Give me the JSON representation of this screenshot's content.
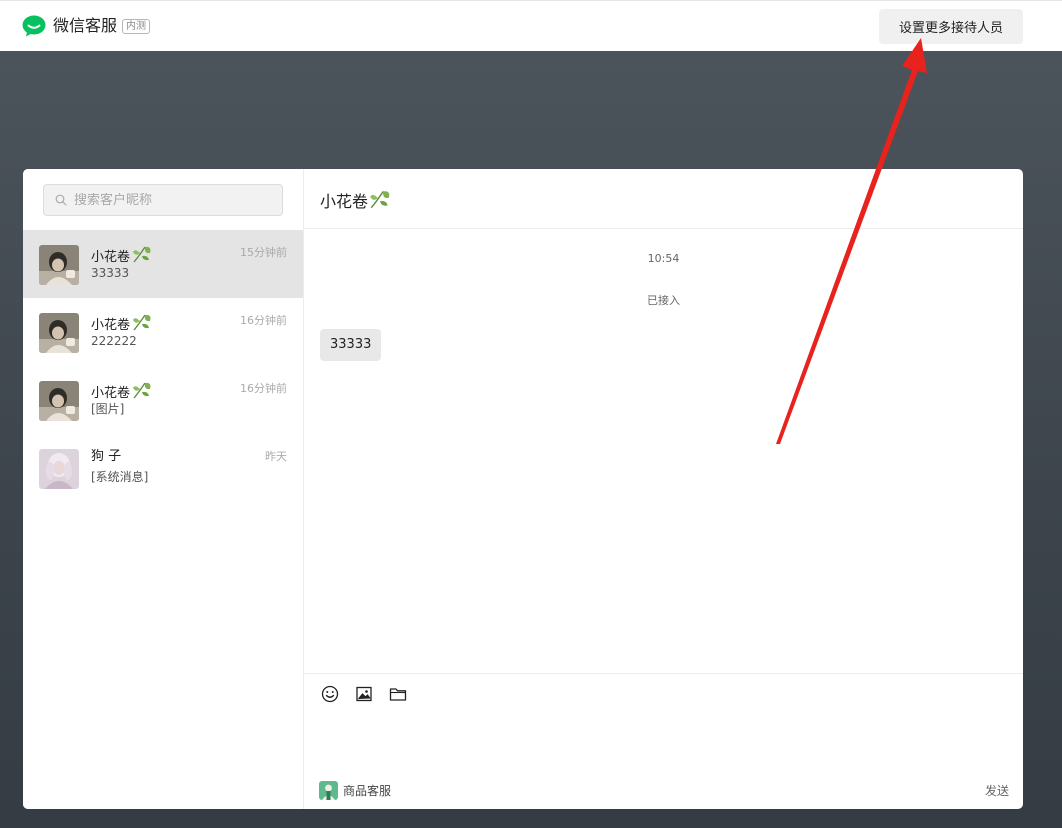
{
  "app": {
    "name": "微信客服",
    "badge": "内测",
    "brand_color": "#07c160"
  },
  "topbar": {
    "action_label": "设置更多接待人员"
  },
  "search": {
    "placeholder": "搜索客户昵称"
  },
  "conversations": [
    {
      "name": "小花卷",
      "last_message": "33333",
      "time": "15分钟前",
      "active": true,
      "avatar": "photo-portrait"
    },
    {
      "name": "小花卷",
      "last_message": "222222",
      "time": "16分钟前",
      "active": false,
      "avatar": "photo-portrait"
    },
    {
      "name": "小花卷",
      "last_message": "[图片]",
      "time": "16分钟前",
      "active": false,
      "avatar": "photo-portrait"
    },
    {
      "name": "狗 子",
      "last_message": "[系统消息]",
      "time": "昨天",
      "active": false,
      "avatar": "photo-pink"
    }
  ],
  "chat": {
    "title": "小花卷",
    "time": "10:54",
    "system_message": "已接入",
    "messages": [
      {
        "text": "33333",
        "from": "customer"
      }
    ]
  },
  "composer": {
    "tools": [
      "emoji-icon",
      "image-icon",
      "folder-icon"
    ],
    "agent_name": "商品客服",
    "send_label": "发送"
  },
  "annotation": {
    "arrow_color": "#e8231e"
  }
}
